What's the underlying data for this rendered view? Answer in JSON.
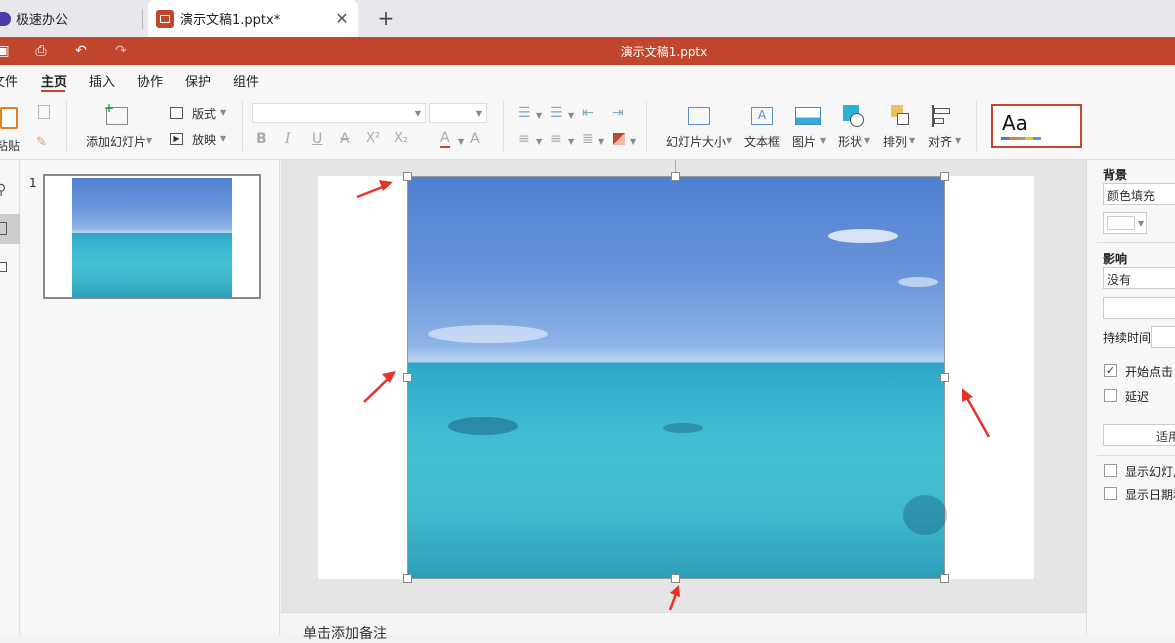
{
  "tabs": [
    {
      "label": "极速办公"
    },
    {
      "label": "演示文稿1.pptx*"
    }
  ],
  "title_bar": {
    "title": "演示文稿1.pptx"
  },
  "menu": {
    "items": [
      "文件",
      "主页",
      "插入",
      "协作",
      "保护",
      "组件"
    ],
    "active": "主页"
  },
  "ribbon": {
    "paste": "粘贴",
    "add_slide": "添加幻灯片",
    "layout": "版式",
    "play": "放映",
    "slide_size": "幻灯片大小",
    "textbox": "文本框",
    "picture": "图片",
    "shape": "形状",
    "arrange": "排列",
    "align": "对齐",
    "theme_preview": "Aa",
    "format_bold": "B",
    "format_italic": "I",
    "format_underline": "U",
    "format_strike": "A",
    "format_super": "X²",
    "format_sub": "X₂",
    "font_color": "A",
    "clear_format": "A"
  },
  "thumbnails": [
    {
      "number": "1"
    }
  ],
  "notes": {
    "placeholder": "单击添加备注"
  },
  "right_panel": {
    "background_label": "背景",
    "background_value": "颜色填充",
    "effect_label": "影响",
    "effect_value": "没有",
    "duration_label": "持续时间",
    "start_on_click": "开始点击",
    "start_on_click_checked": true,
    "delay": "延迟",
    "delay_checked": false,
    "apply": "适用",
    "show_slide_number": "显示幻灯片",
    "show_date": "显示日期和"
  },
  "colors": {
    "accent": "#c0472e",
    "tab_icon": "#c0472e",
    "app_icon": "#4b3aa8"
  }
}
